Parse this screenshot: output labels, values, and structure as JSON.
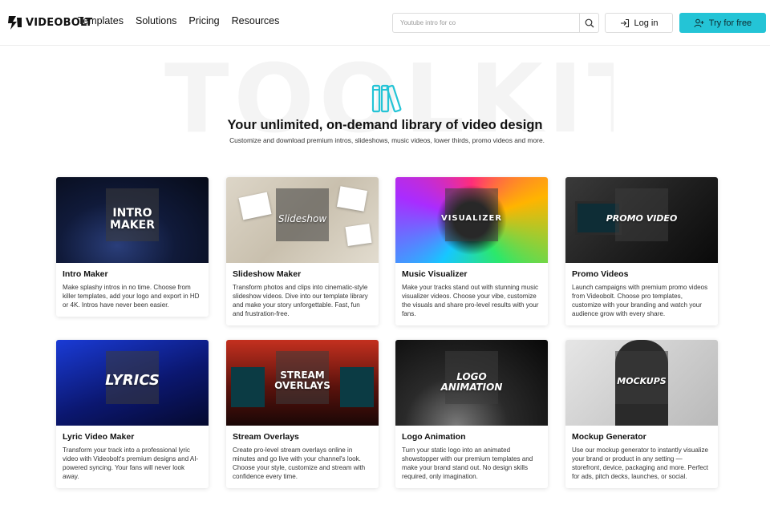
{
  "header": {
    "logo_text": "VIDEOBOLT",
    "nav": [
      "Templates",
      "Solutions",
      "Pricing",
      "Resources"
    ],
    "search_placeholder": "Youtube intro for co",
    "login_label": "Log in",
    "try_label": "Try for free",
    "accent_color": "#24c4d6"
  },
  "hero": {
    "watermark": "TOOLKIT",
    "icon": "books-icon",
    "title": "Your unlimited, on-demand library of video design",
    "subtitle": "Customize and download premium intros, slideshows, music videos, lower thirds, promo videos and more."
  },
  "cards": [
    {
      "title": "Intro Maker",
      "thumb_label": "INTRO\nMAKER",
      "desc": "Make splashy intros in no time. Choose from killer templates, add your logo and export in HD or 4K. Intros have never been easier."
    },
    {
      "title": "Slideshow Maker",
      "thumb_label": "Slideshow",
      "desc": "Transform photos and clips into cinematic-style slideshow videos. Dive into our template library and make your story unforgettable. Fast, fun and frustration-free."
    },
    {
      "title": "Music Visualizer",
      "thumb_label": "VISUALIZER",
      "desc": "Make your tracks stand out with stunning music visualizer videos. Choose your vibe, customize the visuals and share pro-level results with your fans."
    },
    {
      "title": "Promo Videos",
      "thumb_label": "PROMO VIDEO",
      "desc": "Launch campaigns with premium promo videos from Videobolt. Choose pro templates, customize with your branding and watch your audience grow with every share."
    },
    {
      "title": "Lyric Video Maker",
      "thumb_label": "LYRICS",
      "desc": "Transform your track into a professional lyric video with Videobolt's premium designs and AI-powered syncing. Your fans will never look away."
    },
    {
      "title": "Stream Overlays",
      "thumb_label": "STREAM\nOVERLAYS",
      "desc": "Create pro-level stream overlays online in minutes and go live with your channel's look. Choose your style, customize and stream with confidence every time."
    },
    {
      "title": "Logo Animation",
      "thumb_label": "LOGO\nANIMATION",
      "desc": "Turn your static logo into an animated showstopper with our premium templates and make your brand stand out. No design skills required, only imagination."
    },
    {
      "title": "Mockup Generator",
      "thumb_label": "MOCKUPS",
      "desc": "Use our mockup generator to instantly visualize your brand or product in any setting — storefront, device, packaging and more. Perfect for ads, pitch decks, launches, or social."
    }
  ]
}
